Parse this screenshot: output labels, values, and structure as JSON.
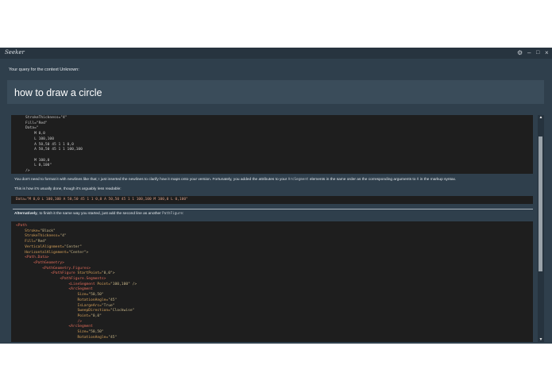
{
  "window": {
    "app_name": "Seeker",
    "controls": {
      "settings": "⚙",
      "minimize": "–",
      "maximize": "□",
      "close": "×"
    }
  },
  "query": {
    "label": "Your query for the context Unknown:",
    "text": "how to draw a circle"
  },
  "answer": {
    "code_block_1": [
      "StrokeThickness=\"4\"",
      "Fill=\"Red\"",
      "Data=\"",
      "    M 0,0",
      "    L 100,100",
      "    A 50,50 45 1 1 0,0",
      "    A 50,50 45 1 1 100,100",
      "",
      "    M 100,0",
      "    L 0,100\"",
      "/>"
    ],
    "paragraph_1": {
      "before": "You don't need to format it with newlines like that; I just inserted the newlines to clarify how it maps onto your version. Fortunately, you added the attributes to your ",
      "code_a": "ArcSegment",
      "middle": " elements in the same order as the corresponding arguments to ",
      "code_b": "A",
      "after": " in the markup syntax."
    },
    "paragraph_2": "This is how it's usually done, though it's arguably less readable:",
    "inline_code": "Data=\"M 0,0 L 100,100 A 50,50 45 1 1 0,0 A 50,50 45 1 1 100,100 M 100,0 L 0,100\"",
    "paragraph_3": {
      "bold": "Alternatively",
      "text": ", to finish it the same way you started, just add the second line as another ",
      "code": "PathFigure",
      "end": ":"
    },
    "code_block_2": [
      {
        "indent": 0,
        "tag": "<Path",
        "attr": "",
        "val": ""
      },
      {
        "indent": 4,
        "tag": "",
        "attr": "Stroke=",
        "val": "\"Black\""
      },
      {
        "indent": 4,
        "tag": "",
        "attr": "StrokeThickness=",
        "val": "\"4\""
      },
      {
        "indent": 4,
        "tag": "",
        "attr": "Fill=",
        "val": "\"Red\""
      },
      {
        "indent": 4,
        "tag": "",
        "attr": "VerticalAlignment=",
        "val": "\"Center\""
      },
      {
        "indent": 4,
        "tag": "",
        "attr": "HorizontalAlignment=",
        "val": "\"Center\">"
      },
      {
        "indent": 4,
        "tag": "<Path.Data>",
        "attr": "",
        "val": ""
      },
      {
        "indent": 8,
        "tag": "<PathGeometry>",
        "attr": "",
        "val": ""
      },
      {
        "indent": 12,
        "tag": "<PathGeometry.Figures>",
        "attr": "",
        "val": ""
      },
      {
        "indent": 16,
        "tag": "<PathFigure ",
        "attr": "StartPoint=",
        "val": "\"0,0\">"
      },
      {
        "indent": 20,
        "tag": "<PathFigure.Segments>",
        "attr": "",
        "val": ""
      },
      {
        "indent": 24,
        "tag": "<LineSegment ",
        "attr": "Point=",
        "val": "\"100,100\" />"
      },
      {
        "indent": 24,
        "tag": "<ArcSegment",
        "attr": "",
        "val": ""
      },
      {
        "indent": 28,
        "tag": "",
        "attr": "Size=",
        "val": "\"50,50\""
      },
      {
        "indent": 28,
        "tag": "",
        "attr": "RotationAngle=",
        "val": "\"45\""
      },
      {
        "indent": 28,
        "tag": "",
        "attr": "IsLargeArc=",
        "val": "\"True\""
      },
      {
        "indent": 28,
        "tag": "",
        "attr": "SweepDirection=",
        "val": "\"Clockwise\""
      },
      {
        "indent": 28,
        "tag": "",
        "attr": "Point=",
        "val": "\"0,0\""
      },
      {
        "indent": 28,
        "tag": "/>",
        "attr": "",
        "val": ""
      },
      {
        "indent": 24,
        "tag": "<ArcSegment",
        "attr": "",
        "val": ""
      },
      {
        "indent": 28,
        "tag": "",
        "attr": "Size=",
        "val": "\"50,50\""
      },
      {
        "indent": 28,
        "tag": "",
        "attr": "RotationAngle=",
        "val": "\"45\""
      }
    ]
  },
  "colors": {
    "window_bg": "#2f3f4c",
    "query_box_bg": "#3a4c5a",
    "code_bg": "#1e1e1e",
    "xml_tag": "#e06c5a",
    "xml_attr": "#d7a25a",
    "xml_value": "#c9b78a"
  }
}
